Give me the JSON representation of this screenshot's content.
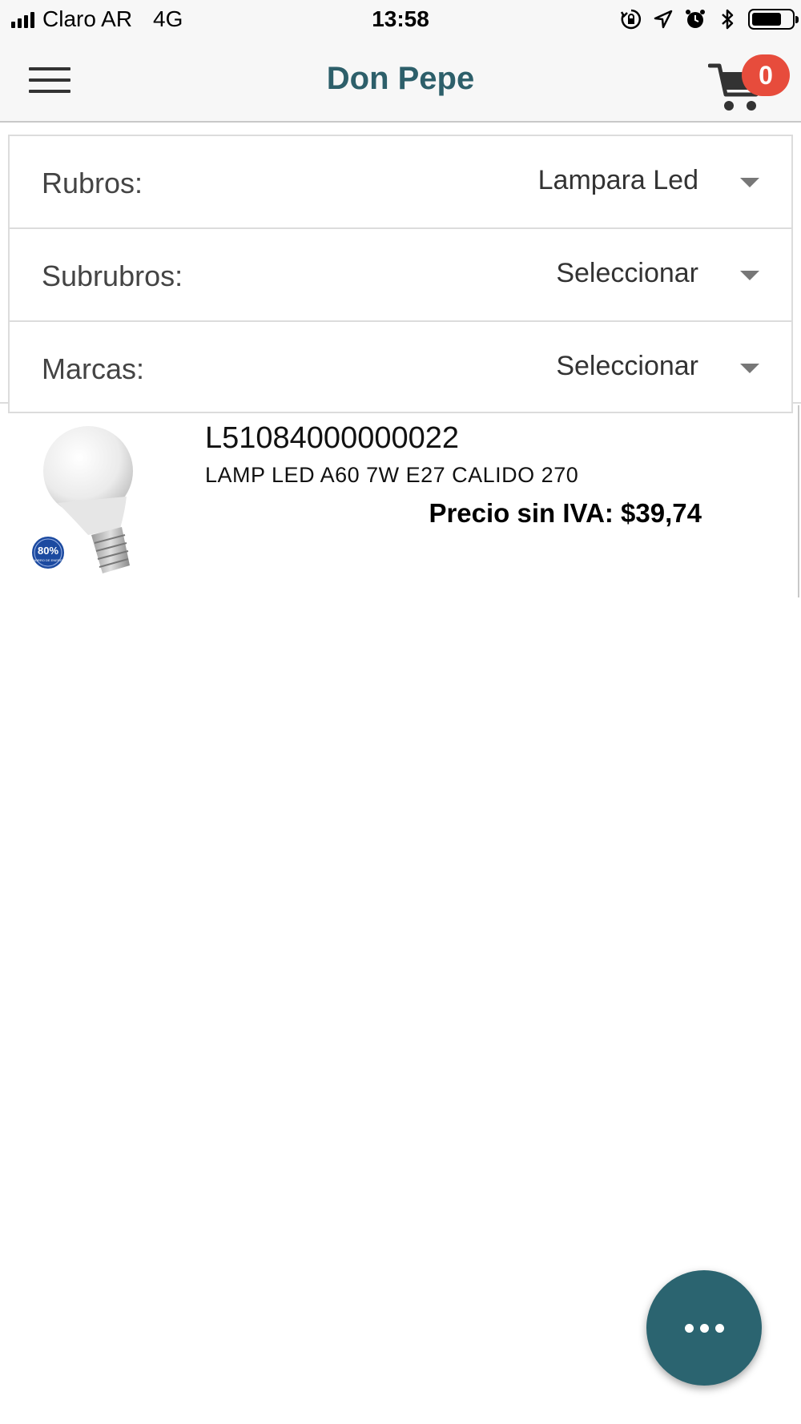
{
  "status_bar": {
    "carrier": "Claro AR",
    "network": "4G",
    "time": "13:58",
    "battery_level": 0.75,
    "icons": [
      "signal-icon",
      "rotation-lock-icon",
      "location-icon",
      "alarm-icon",
      "bluetooth-icon",
      "battery-icon"
    ]
  },
  "nav": {
    "title": "Don Pepe",
    "menu_icon": "hamburger-menu-icon",
    "cart_icon": "cart-icon",
    "cart_count": "0"
  },
  "filters": [
    {
      "label": "Rubros:",
      "value": "Lampara Led"
    },
    {
      "label": "Subrubros:",
      "value": "Seleccionar"
    },
    {
      "label": "Marcas:",
      "value": "Seleccionar"
    }
  ],
  "products": [
    {
      "code": "L51084000000022",
      "description": "LAMP LED A60 7W E27 CALIDO 270",
      "price": "Precio sin IVA: $39,74",
      "image_badge": "80%",
      "image_badge_sub": "AHORRO DE ENERGIA"
    }
  ],
  "fab": {
    "icon": "more-options-icon"
  },
  "colors": {
    "brand": "#2d5f6a",
    "fab": "#2b6470",
    "badge": "#e74c3c"
  }
}
